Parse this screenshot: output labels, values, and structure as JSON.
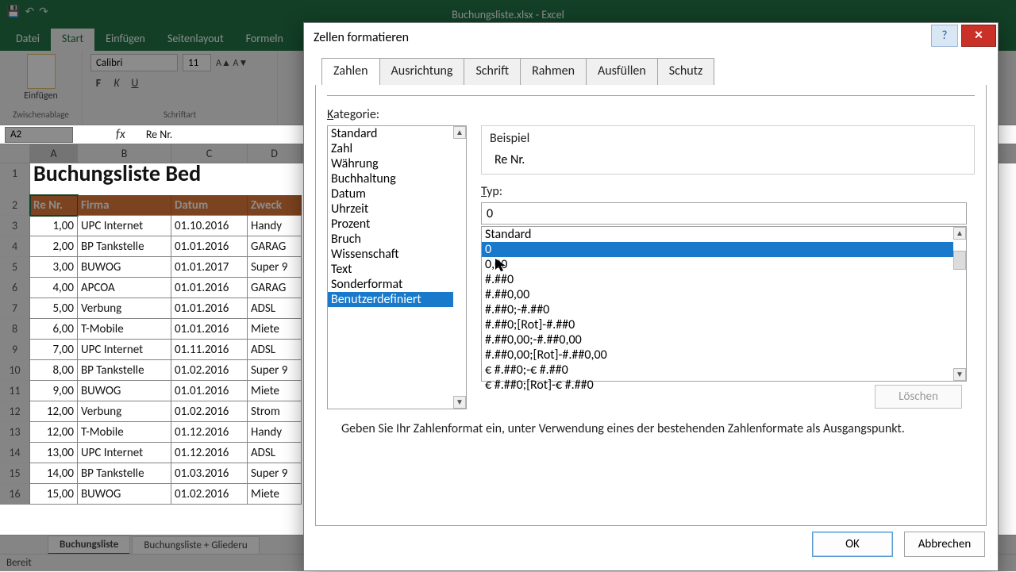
{
  "app": {
    "title": "Buchungsliste.xlsx - Excel"
  },
  "qat": {
    "save": "💾",
    "undo": "↶",
    "redo": "↷"
  },
  "ribbon_tabs": [
    "Datei",
    "Start",
    "Einfügen",
    "Seitenlayout",
    "Formeln"
  ],
  "ribbon": {
    "paste": "Einfügen",
    "clipboard_label": "Zwischenablage",
    "font_name": "Calibri",
    "font_size": "11",
    "font_label": "Schriftart",
    "bold": "F",
    "italic": "K",
    "underline": "U"
  },
  "namebox": "A2",
  "fx_value": "Re Nr.",
  "columns": [
    "A",
    "B",
    "C",
    "D"
  ],
  "bigtitle": "Buchungsliste Bed",
  "headers": [
    "Re Nr.",
    "Firma",
    "Datum",
    "Zweck"
  ],
  "rows": [
    [
      "1,00",
      "UPC Internet",
      "01.10.2016",
      "Handy"
    ],
    [
      "2,00",
      "BP Tankstelle",
      "01.01.2016",
      "GARAG"
    ],
    [
      "3,00",
      "BUWOG",
      "01.01.2017",
      "Super 9"
    ],
    [
      "4,00",
      "APCOA",
      "01.01.2016",
      "GARAG"
    ],
    [
      "5,00",
      "Verbung",
      "01.01.2016",
      "ADSL"
    ],
    [
      "6,00",
      "T-Mobile",
      "01.01.2016",
      "Miete"
    ],
    [
      "7,00",
      "UPC Internet",
      "01.11.2016",
      "ADSL"
    ],
    [
      "8,00",
      "BP Tankstelle",
      "01.02.2016",
      "Super 9"
    ],
    [
      "9,00",
      "BUWOG",
      "01.01.2016",
      "Miete"
    ],
    [
      "12,00",
      "Verbung",
      "01.02.2016",
      "Strom"
    ],
    [
      "12,00",
      "T-Mobile",
      "01.12.2016",
      "Handy"
    ],
    [
      "13,00",
      "UPC Internet",
      "01.12.2016",
      "ADSL"
    ],
    [
      "14,00",
      "BP Tankstelle",
      "01.03.2016",
      "Super 9"
    ],
    [
      "15,00",
      "BUWOG",
      "01.02.2016",
      "Miete"
    ]
  ],
  "sheet_tabs": [
    "Buchungsliste",
    "Buchungsliste + Gliederu"
  ],
  "status": "Bereit",
  "dialog": {
    "title": "Zellen formatieren",
    "tabs": [
      "Zahlen",
      "Ausrichtung",
      "Schrift",
      "Rahmen",
      "Ausfüllen",
      "Schutz"
    ],
    "kat_label": "Kategorie:",
    "categories": [
      "Standard",
      "Zahl",
      "Währung",
      "Buchhaltung",
      "Datum",
      "Uhrzeit",
      "Prozent",
      "Bruch",
      "Wissenschaft",
      "Text",
      "Sonderformat",
      "Benutzerdefiniert"
    ],
    "beispiel_label": "Beispiel",
    "beispiel_value": "Re Nr.",
    "typ_label": "Typ:",
    "typ_value": "0",
    "typ_list": [
      "Standard",
      "0",
      "0,00",
      "#.##0",
      "#.##0,00",
      "#.##0;-#.##0",
      "#.##0;[Rot]-#.##0",
      "#.##0,00;-#.##0,00",
      "#.##0,00;[Rot]-#.##0,00",
      "€ #.##0;-€ #.##0",
      "€ #.##0;[Rot]-€ #.##0"
    ],
    "delete_btn": "Löschen",
    "hint": "Geben Sie Ihr Zahlenformat ein, unter Verwendung eines der bestehenden Zahlenformate als Ausgangspunkt.",
    "ok": "OK",
    "cancel": "Abbrechen"
  }
}
